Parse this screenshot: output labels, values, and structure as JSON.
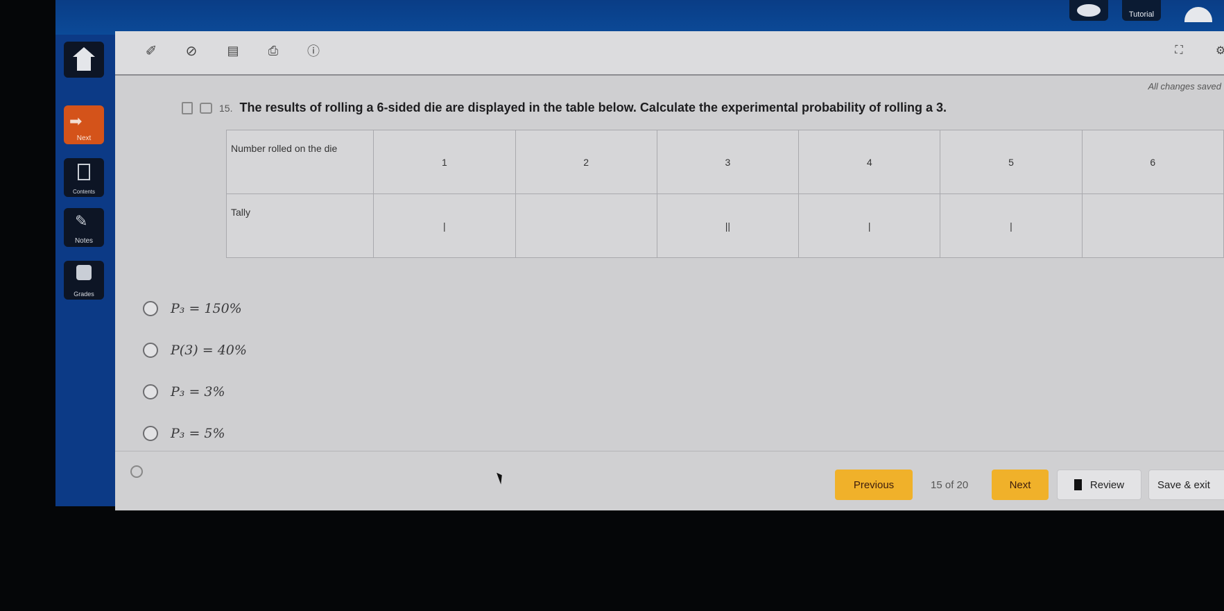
{
  "header": {
    "tutorial_label": "Tutorial",
    "chat_icon": "speech-bubble-icon",
    "profile_icon": "user-icon"
  },
  "sidebar": {
    "home_icon": "home-icon",
    "items": [
      {
        "label": "Next",
        "icon": "arrow-right-icon"
      },
      {
        "label": "Contents",
        "icon": "document-list-icon"
      },
      {
        "label": "Notes",
        "icon": "pencil-icon"
      },
      {
        "label": "Grades",
        "icon": "grades-icon"
      }
    ]
  },
  "toolbar": {
    "icons": [
      "highlighter-icon",
      "eliminator-icon",
      "notepad-icon",
      "print-icon",
      "info-icon"
    ],
    "fullscreen_icon": "fullscreen-icon",
    "status": "All changes saved"
  },
  "question": {
    "number": "15.",
    "text": "The results of rolling a 6-sided die are displayed in the table below. Calculate the experimental probability of rolling a 3."
  },
  "table": {
    "row_headers": [
      "Number rolled on the die",
      "Tally"
    ],
    "numbers": [
      "1",
      "2",
      "3",
      "4",
      "5",
      "6"
    ],
    "tallies": [
      "|",
      "",
      "||",
      "|",
      "|",
      ""
    ]
  },
  "choices": [
    {
      "text": "P₃ = 150%",
      "selected": false
    },
    {
      "text": "P(3) = 40%",
      "selected": false
    },
    {
      "text": "P₃ = 3%",
      "selected": false
    },
    {
      "text": "P₃ = 5%",
      "selected": false
    }
  ],
  "footer": {
    "previous_label": "Previous",
    "counter": "15 of 20",
    "next_label": "Next",
    "review_label": "Review",
    "save_exit_label": "Save & exit"
  },
  "colors": {
    "brand_blue": "#0b4a98",
    "next_orange": "#d4531a",
    "button_yellow": "#f0b12a"
  }
}
